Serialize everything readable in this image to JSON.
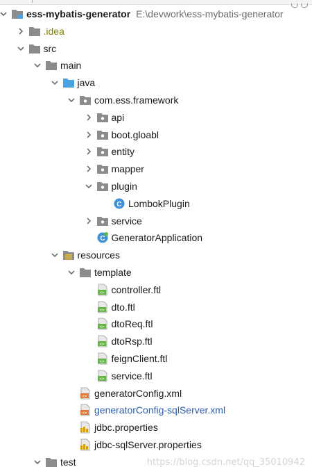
{
  "project": {
    "name": "ess-mybatis-generator",
    "path": "E:\\devwork\\ess-mybatis-generator"
  },
  "tree": [
    {
      "label": "ess-mybatis-generator",
      "name": "project-root",
      "depth": 0,
      "arrow": "down",
      "icon": "module-folder",
      "bold": true
    },
    {
      "label": ".idea",
      "name": "idea-folder",
      "depth": 1,
      "arrow": "right",
      "icon": "folder",
      "style": "muted"
    },
    {
      "label": "src",
      "name": "src-folder",
      "depth": 1,
      "arrow": "down",
      "icon": "folder"
    },
    {
      "label": "main",
      "name": "main-folder",
      "depth": 2,
      "arrow": "down",
      "icon": "folder"
    },
    {
      "label": "java",
      "name": "java-folder",
      "depth": 3,
      "arrow": "down",
      "icon": "source-folder"
    },
    {
      "label": "com.ess.framework",
      "name": "package-com-ess-framework",
      "depth": 4,
      "arrow": "down",
      "icon": "package"
    },
    {
      "label": "api",
      "name": "package-api",
      "depth": 5,
      "arrow": "right",
      "icon": "package"
    },
    {
      "label": "boot.gloabl",
      "name": "package-boot-gloabl",
      "depth": 5,
      "arrow": "right",
      "icon": "package"
    },
    {
      "label": "entity",
      "name": "package-entity",
      "depth": 5,
      "arrow": "right",
      "icon": "package"
    },
    {
      "label": "mapper",
      "name": "package-mapper",
      "depth": 5,
      "arrow": "right",
      "icon": "package"
    },
    {
      "label": "plugin",
      "name": "package-plugin",
      "depth": 5,
      "arrow": "down",
      "icon": "package"
    },
    {
      "label": "LombokPlugin",
      "name": "class-lombok-plugin",
      "depth": 6,
      "arrow": "none",
      "icon": "class"
    },
    {
      "label": "service",
      "name": "package-service",
      "depth": 5,
      "arrow": "right",
      "icon": "package"
    },
    {
      "label": "GeneratorApplication",
      "name": "class-generator-application",
      "depth": 5,
      "arrow": "none",
      "icon": "spring-class"
    },
    {
      "label": "resources",
      "name": "resources-folder",
      "depth": 3,
      "arrow": "down",
      "icon": "resources-folder"
    },
    {
      "label": "template",
      "name": "template-folder",
      "depth": 4,
      "arrow": "down",
      "icon": "folder"
    },
    {
      "label": "controller.ftl",
      "name": "file-controller-ftl",
      "depth": 5,
      "arrow": "none",
      "icon": "ftl-file"
    },
    {
      "label": "dto.ftl",
      "name": "file-dto-ftl",
      "depth": 5,
      "arrow": "none",
      "icon": "ftl-file"
    },
    {
      "label": "dtoReq.ftl",
      "name": "file-dtoreq-ftl",
      "depth": 5,
      "arrow": "none",
      "icon": "ftl-file"
    },
    {
      "label": "dtoRsp.ftl",
      "name": "file-dtorsp-ftl",
      "depth": 5,
      "arrow": "none",
      "icon": "ftl-file"
    },
    {
      "label": "feignClient.ftl",
      "name": "file-feignclient-ftl",
      "depth": 5,
      "arrow": "none",
      "icon": "ftl-file"
    },
    {
      "label": "service.ftl",
      "name": "file-service-ftl",
      "depth": 5,
      "arrow": "none",
      "icon": "ftl-file"
    },
    {
      "label": "generatorConfig.xml",
      "name": "file-generatorconfig-xml",
      "depth": 4,
      "arrow": "none",
      "icon": "xml-file"
    },
    {
      "label": "generatorConfig-sqlServer.xml",
      "name": "file-generatorconfig-sqlserver-xml",
      "depth": 4,
      "arrow": "none",
      "icon": "xml-file",
      "style": "link"
    },
    {
      "label": "jdbc.properties",
      "name": "file-jdbc-properties",
      "depth": 4,
      "arrow": "none",
      "icon": "properties-file"
    },
    {
      "label": "jdbc-sqlServer.properties",
      "name": "file-jdbc-sqlserver-properties",
      "depth": 4,
      "arrow": "none",
      "icon": "properties-file"
    },
    {
      "label": "test",
      "name": "test-folder",
      "depth": 2,
      "arrow": "down",
      "icon": "folder"
    }
  ],
  "watermark": "https://blog.csdn.net/qq_35010942",
  "colors": {
    "folder": "#8c8c8c",
    "source_folder": "#4aa3df",
    "class_circle": "#3f8fd6",
    "ftl_green": "#62b543",
    "xml_orange": "#e0793a",
    "properties_yellow": "#d4a017",
    "arrow": "#6e6e6e"
  }
}
